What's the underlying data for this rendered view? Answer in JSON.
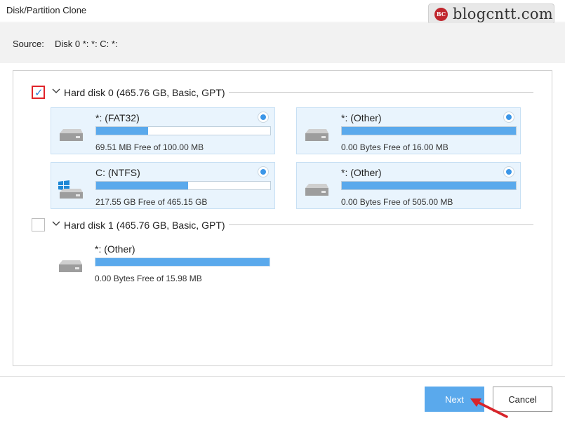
{
  "window": {
    "title": "Disk/Partition Clone"
  },
  "watermark": {
    "logo": "BC",
    "text": "blogcntt.com"
  },
  "source": {
    "label": "Source:",
    "value": "Disk 0 *: *: C: *:"
  },
  "disks": [
    {
      "label": "Hard disk 0 (465.76 GB, Basic, GPT)",
      "checked": true,
      "partitions": [
        {
          "name": "*: (FAT32)",
          "free": "69.51 MB Free of 100.00 MB",
          "used_fraction": 0.3,
          "icon": "drive-icon"
        },
        {
          "name": "*: (Other)",
          "free": "0.00 Bytes Free of 16.00 MB",
          "used_fraction": 1.0,
          "icon": "drive-icon"
        },
        {
          "name": "C: (NTFS)",
          "free": "217.55 GB Free of 465.15 GB",
          "used_fraction": 0.53,
          "icon": "windows-drive-icon"
        },
        {
          "name": "*: (Other)",
          "free": "0.00 Bytes Free of 505.00 MB",
          "used_fraction": 1.0,
          "icon": "drive-icon"
        }
      ]
    },
    {
      "label": "Hard disk 1 (465.76 GB, Basic, GPT)",
      "checked": false,
      "partitions": [
        {
          "name": "*: (Other)",
          "free": "0.00 Bytes Free of 15.98 MB",
          "used_fraction": 1.0,
          "icon": "drive-icon"
        }
      ]
    }
  ],
  "buttons": {
    "next": "Next",
    "cancel": "Cancel"
  },
  "colors": {
    "accent": "#5aa9ec",
    "selected_bg": "#e9f4fd",
    "highlight": "#e0242a"
  }
}
